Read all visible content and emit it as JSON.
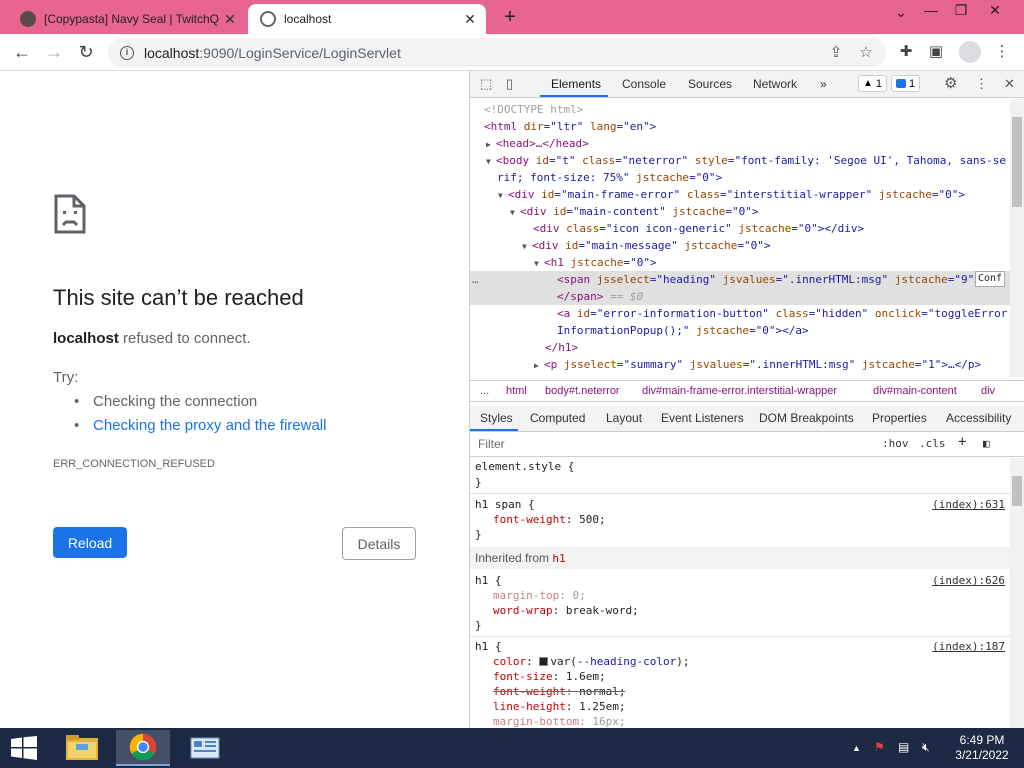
{
  "browser": {
    "tabs": [
      {
        "title": "[Copypasta] Navy Seal | TwitchQ"
      },
      {
        "title": "localhost"
      }
    ],
    "address": {
      "host": "localhost",
      "path": ":9090/LoginService/LoginServlet"
    }
  },
  "page": {
    "heading": "This site can’t be reached",
    "summary_host": "localhost",
    "summary_rest": " refused to connect.",
    "try_label": "Try:",
    "suggestions": [
      "Checking the connection",
      "Checking the proxy and the firewall"
    ],
    "error_code": "ERR_CONNECTION_REFUSED",
    "reload_label": "Reload",
    "details_label": "Details"
  },
  "devtools": {
    "tabs": [
      "Elements",
      "Console",
      "Sources",
      "Network"
    ],
    "more": "»",
    "warn_count": "1",
    "info_count": "1",
    "dom": {
      "l0": "<!DOCTYPE html>",
      "l1a": "<html ",
      "l1b": "dir",
      "l1c": "=\"ltr\" ",
      "l1d": "lang",
      "l1e": "=\"en\">",
      "l2": "<head>…</head>",
      "l3a": "<body ",
      "l3b": "id",
      "l3c": "=\"t\" ",
      "l3d": "class",
      "l3e": "=\"neterror\" ",
      "l3f": "style",
      "l3g": "=\"font-family: 'Segoe UI', Tahoma, sans-se",
      "l4a": "rif; font-size: 75%\" ",
      "l4b": "jstcache",
      "l4c": "=\"0\">",
      "l5a": "<div ",
      "l5b": "id",
      "l5c": "=\"main-frame-error\" ",
      "l5d": "class",
      "l5e": "=\"interstitial-wrapper\" ",
      "l5f": "jstcache",
      "l5g": "=\"0\">",
      "l6a": "<div ",
      "l6b": "id",
      "l6c": "=\"main-content\" ",
      "l6d": "jstcache",
      "l6e": "=\"0\">",
      "l7a": "<div ",
      "l7b": "class",
      "l7c": "=\"icon icon-generic\" ",
      "l7d": "jstcache",
      "l7e": "=\"0\"></div>",
      "l8a": "<div ",
      "l8b": "id",
      "l8c": "=\"main-message\" ",
      "l8d": "jstcache",
      "l8e": "=\"0\">",
      "l9a": "<h1 ",
      "l9b": "jstcache",
      "l9c": "=\"0\">",
      "l10a": "<span ",
      "l10b": "jsselect",
      "l10c": "=\"heading\" ",
      "l10d": "jsvalues",
      "l10e": "=\".innerHTML:msg\" ",
      "l10f": "jstcache",
      "l10g": "=\"9\">",
      "l10h": "Conf",
      "l11a": "</span>",
      "l11b": " == $0",
      "l12a": "<a ",
      "l12b": "id",
      "l12c": "=\"error-information-button\" ",
      "l12d": "class",
      "l12e": "=\"hidden\" ",
      "l12f": "onclick",
      "l12g": "=\"toggleError",
      "l13a": "InformationPopup();\" ",
      "l13b": "jstcache",
      "l13c": "=\"0\"></a>",
      "l14": "</h1>",
      "l15a": "<p ",
      "l15b": "jsselect",
      "l15c": "=\"summary\" ",
      "l15d": "jsvalues",
      "l15e": "=\".innerHTML:msg\" ",
      "l15f": "jstcache",
      "l15g": "=\"1\">…</p>"
    },
    "ellipsis": "…",
    "crumbs": [
      "...",
      "html",
      "body#t.neterror",
      "div#main-frame-error.interstitial-wrapper",
      "div#main-content",
      "div"
    ],
    "style_tabs": [
      "Styles",
      "Computed",
      "Layout",
      "Event Listeners",
      "DOM Breakpoints",
      "Properties",
      "Accessibility"
    ],
    "filter_placeholder": "Filter",
    "hov": ":hov",
    "cls": ".cls",
    "plus": "+",
    "styles": {
      "element_style": "element.style {",
      "close": "}",
      "r1_sel": "h1 span {",
      "r1_src": "(index):631",
      "r1_p1": "font-weight",
      "r1_v1": "500;",
      "inherited": "Inherited from ",
      "inherited_el": "h1",
      "r2_sel": "h1 {",
      "r2_src": "(index):626",
      "r2_p1": "margin-top",
      "r2_v1": "0;",
      "r2_p2": "word-wrap",
      "r2_v2": "break-word;",
      "r3_sel": "h1 {",
      "r3_src": "(index):187",
      "r3_p1": "color",
      "r3_v1a": "var(",
      "r3_v1b": "--heading-color",
      "r3_v1c": ");",
      "r3_p2": "font-size",
      "r3_v2": "1.6em;",
      "r3_p3": "font-weight",
      "r3_v3": "normal;",
      "r3_p4": "line-height",
      "r3_v4": "1.25em;",
      "r3_p5": "margin-bottom",
      "r3_v5": "16px;"
    }
  },
  "taskbar": {
    "time": "6:49 PM",
    "date": "3/21/2022"
  }
}
